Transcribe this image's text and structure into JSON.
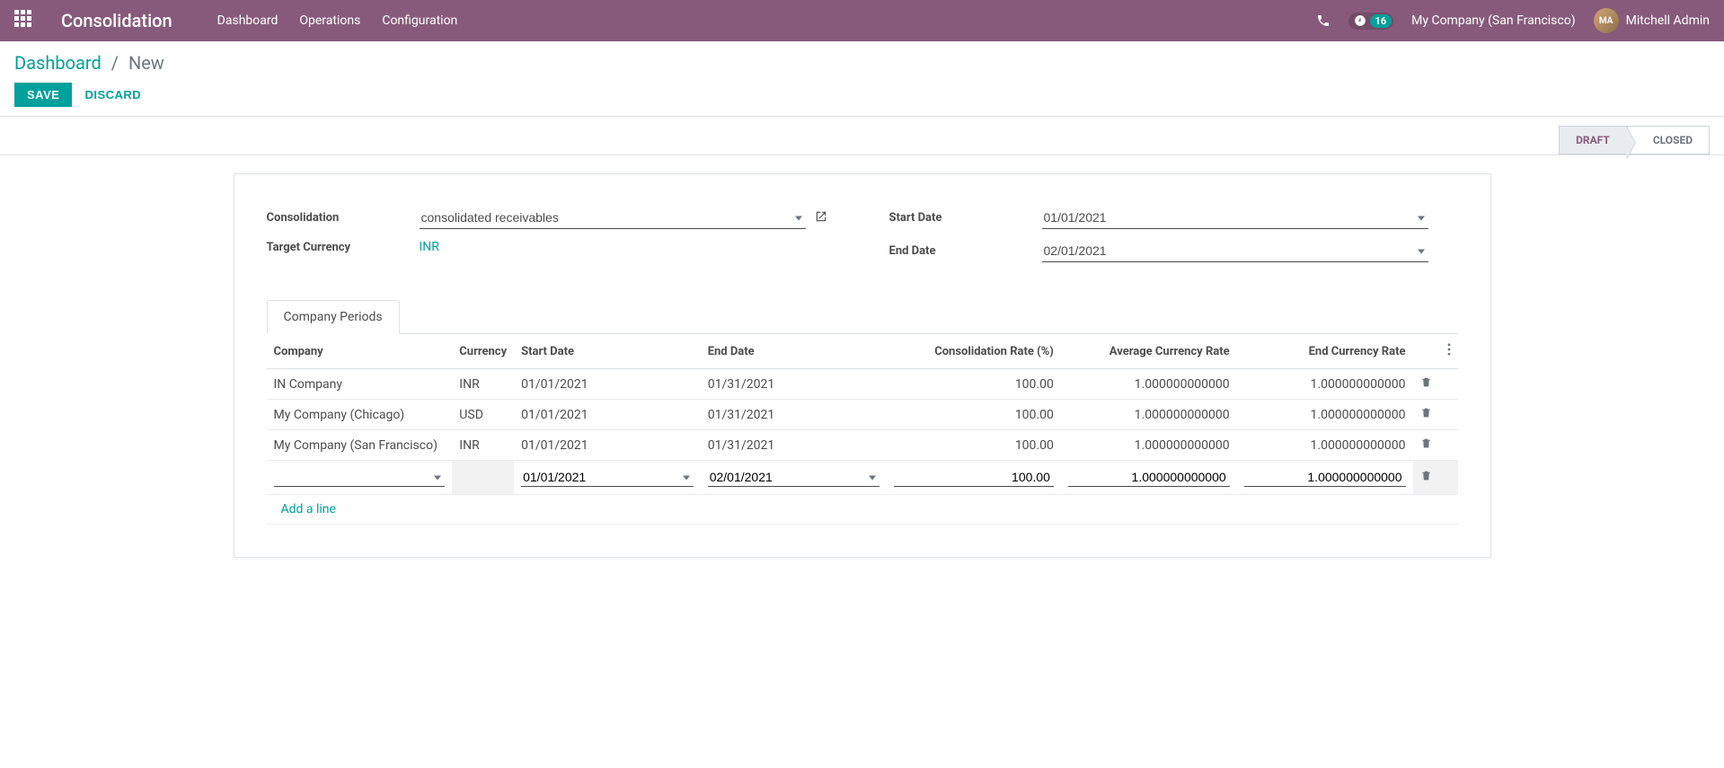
{
  "navbar": {
    "brand": "Consolidation",
    "menu": [
      {
        "label": "Dashboard"
      },
      {
        "label": "Operations"
      },
      {
        "label": "Configuration"
      }
    ],
    "notif_count": "16",
    "company": "My Company (San Francisco)",
    "user": "Mitchell Admin"
  },
  "breadcrumb": {
    "root": "Dashboard",
    "current": "New"
  },
  "buttons": {
    "save": "SAVE",
    "discard": "DISCARD"
  },
  "status": {
    "draft": "DRAFT",
    "closed": "CLOSED"
  },
  "form": {
    "labels": {
      "consolidation": "Consolidation",
      "target_currency": "Target Currency",
      "start_date": "Start Date",
      "end_date": "End Date"
    },
    "values": {
      "consolidation": "consolidated receivables",
      "target_currency": "INR",
      "start_date": "01/01/2021",
      "end_date": "02/01/2021"
    }
  },
  "tabs": {
    "company_periods": "Company Periods"
  },
  "table": {
    "columns": {
      "company": "Company",
      "currency": "Currency",
      "start_date": "Start Date",
      "end_date": "End Date",
      "consolidation_rate": "Consolidation Rate (%)",
      "avg_rate": "Average Currency Rate",
      "end_rate": "End Currency Rate"
    },
    "rows": [
      {
        "company": "IN Company",
        "currency": "INR",
        "start_date": "01/01/2021",
        "end_date": "01/31/2021",
        "rate": "100.00",
        "avg": "1.000000000000",
        "end": "1.000000000000"
      },
      {
        "company": "My Company (Chicago)",
        "currency": "USD",
        "start_date": "01/01/2021",
        "end_date": "01/31/2021",
        "rate": "100.00",
        "avg": "1.000000000000",
        "end": "1.000000000000"
      },
      {
        "company": "My Company (San Francisco)",
        "currency": "INR",
        "start_date": "01/01/2021",
        "end_date": "01/31/2021",
        "rate": "100.00",
        "avg": "1.000000000000",
        "end": "1.000000000000"
      }
    ],
    "edit_row": {
      "company": "",
      "currency": "",
      "start_date": "01/01/2021",
      "end_date": "02/01/2021",
      "rate": "100.00",
      "avg": "1.000000000000",
      "end": "1.000000000000"
    },
    "add_line": "Add a line"
  }
}
